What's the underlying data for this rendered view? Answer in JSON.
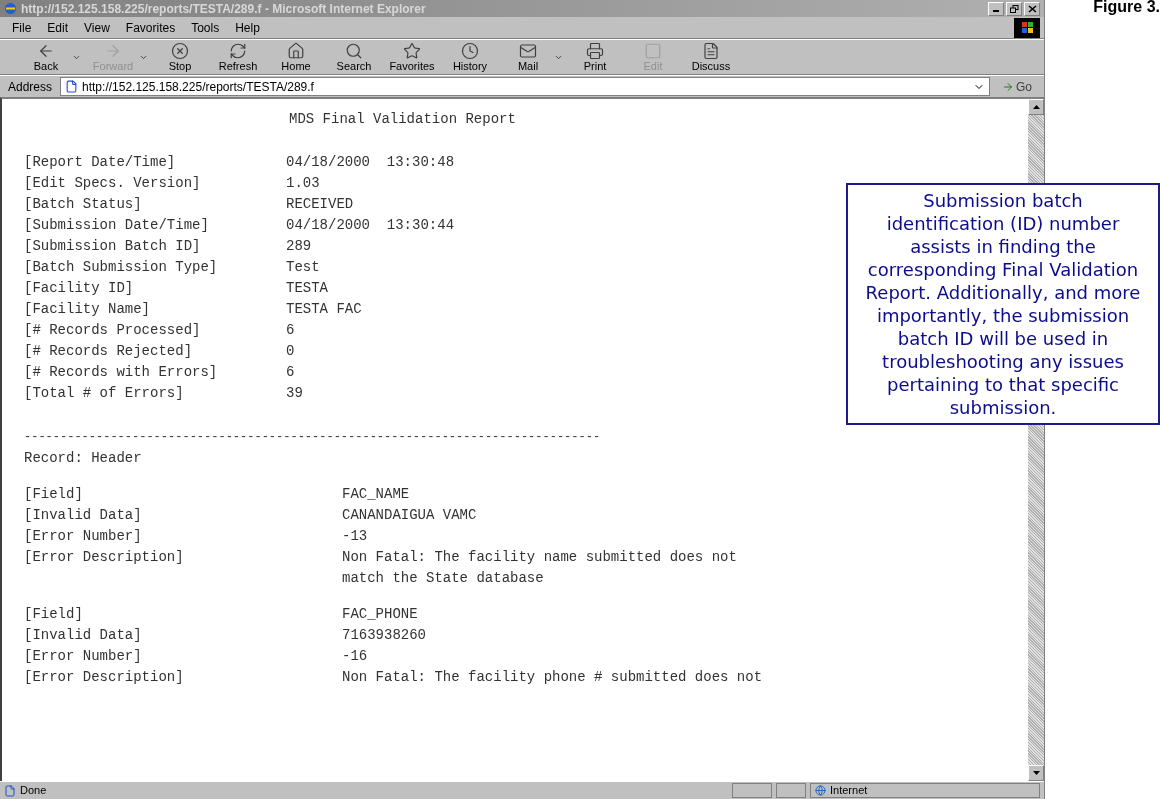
{
  "window": {
    "title": "http://152.125.158.225/reports/TESTA/289.f - Microsoft Internet Explorer"
  },
  "figure_label": "Figure 3.",
  "menu": [
    "File",
    "Edit",
    "View",
    "Favorites",
    "Tools",
    "Help"
  ],
  "toolbar": [
    {
      "label": "Back",
      "disabled": false,
      "dropdown": true
    },
    {
      "label": "Forward",
      "disabled": true,
      "dropdown": true
    },
    {
      "label": "Stop",
      "disabled": false,
      "dropdown": false
    },
    {
      "label": "Refresh",
      "disabled": false,
      "dropdown": false
    },
    {
      "label": "Home",
      "disabled": false,
      "dropdown": false
    },
    {
      "label": "Search",
      "disabled": false,
      "dropdown": false
    },
    {
      "label": "Favorites",
      "disabled": false,
      "dropdown": false
    },
    {
      "label": "History",
      "disabled": false,
      "dropdown": false
    },
    {
      "label": "Mail",
      "disabled": false,
      "dropdown": true
    },
    {
      "label": "Print",
      "disabled": false,
      "dropdown": false
    },
    {
      "label": "Edit",
      "disabled": true,
      "dropdown": false
    },
    {
      "label": "Discuss",
      "disabled": false,
      "dropdown": false
    }
  ],
  "address": {
    "label": "Address",
    "value": "http://152.125.158.225/reports/TESTA/289.f",
    "go": "Go"
  },
  "report": {
    "title": "MDS Final Validation Report",
    "summary": [
      {
        "label": "[Report Date/Time]",
        "value": "04/18/2000  13:30:48"
      },
      {
        "label": "[Edit Specs. Version]",
        "value": "1.03"
      },
      {
        "label": "[Batch Status]",
        "value": "RECEIVED"
      },
      {
        "label": "[Submission Date/Time]",
        "value": "04/18/2000  13:30:44"
      },
      {
        "label": "[Submission Batch ID]",
        "value": "289"
      },
      {
        "label": "[Batch Submission Type]",
        "value": "Test"
      },
      {
        "label": "[Facility ID]",
        "value": "TESTA"
      },
      {
        "label": "[Facility Name]",
        "value": "TESTA FAC"
      },
      {
        "label": "[# Records Processed]",
        "value": "6"
      },
      {
        "label": "[# Records Rejected]",
        "value": "0"
      },
      {
        "label": "[# Records with Errors]",
        "value": "6"
      },
      {
        "label": "[Total # of Errors]",
        "value": "39"
      }
    ],
    "separator": "--------------------------------------------------------------------------------",
    "record": "Record: Header",
    "errors": [
      {
        "rows": [
          {
            "label": "[Field]",
            "lines": [
              "FAC_NAME"
            ]
          },
          {
            "label": "[Invalid Data]",
            "lines": [
              "CANANDAIGUA VAMC"
            ]
          },
          {
            "label": "[Error Number]",
            "lines": [
              "-13"
            ]
          },
          {
            "label": "[Error Description]",
            "lines": [
              "Non Fatal: The facility name submitted does not",
              "match the State database"
            ]
          }
        ]
      },
      {
        "rows": [
          {
            "label": "[Field]",
            "lines": [
              "FAC_PHONE"
            ]
          },
          {
            "label": "[Invalid Data]",
            "lines": [
              "7163938260"
            ]
          },
          {
            "label": "[Error Number]",
            "lines": [
              "-16"
            ]
          },
          {
            "label": "[Error Description]",
            "lines": [
              "Non Fatal: The facility phone # submitted does not"
            ]
          }
        ]
      }
    ]
  },
  "callout": "Submission batch identification (ID) number assists in finding the corresponding Final Validation Report. Additionally, and more importantly, the submission batch ID will be used in troubleshooting any issues pertaining to that specific submission.",
  "status_bar": {
    "text": "Done",
    "zone": "Internet"
  }
}
